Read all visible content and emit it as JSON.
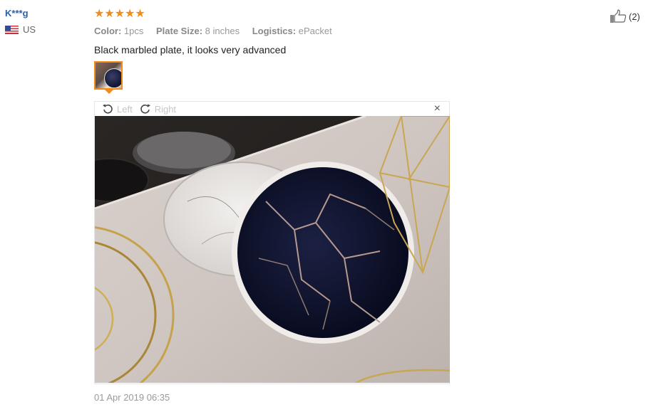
{
  "user": {
    "name": "K***g",
    "country": "US"
  },
  "review": {
    "rating_stars": "★★★★★",
    "rating": 5,
    "attributes": [
      {
        "key": "Color:",
        "value": "1pcs"
      },
      {
        "key": "Plate Size:",
        "value": "8 inches"
      },
      {
        "key": "Logistics:",
        "value": "ePacket"
      }
    ],
    "text": "Black marbled plate, it looks very advanced",
    "date": "01 Apr 2019 06:35"
  },
  "viewer": {
    "rotate_left": "Left",
    "rotate_right": "Right",
    "close": "×"
  },
  "helpful": {
    "count": "(2)",
    "icon": "thumbs-up-icon"
  },
  "colors": {
    "accent": "#f38b19",
    "username": "#2d5fa8"
  }
}
